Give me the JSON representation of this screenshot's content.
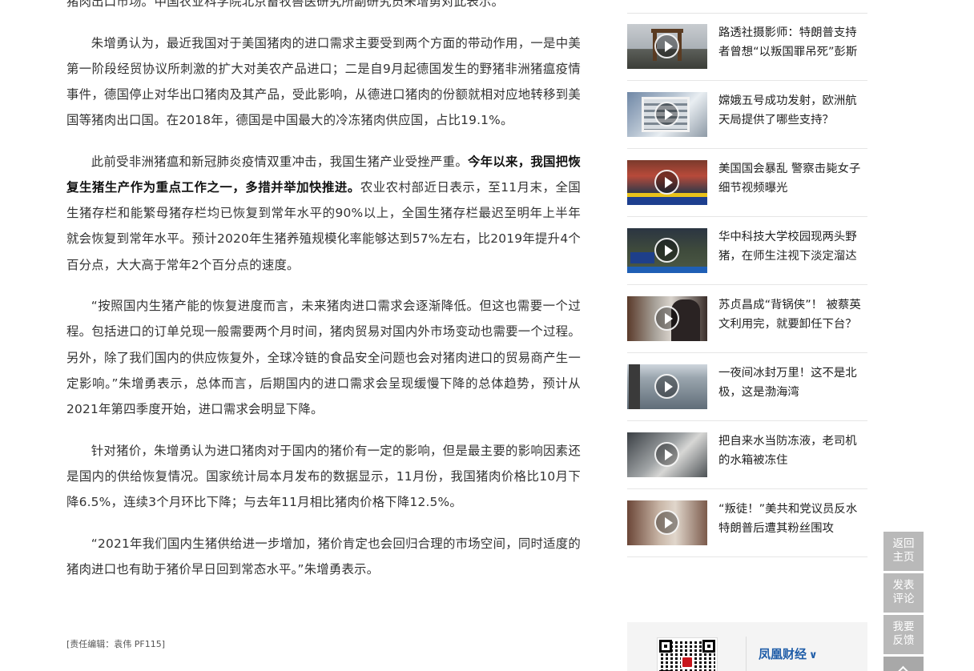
{
  "article": {
    "paragraphs": [
      {
        "parts": [
          {
            "text": "猪肉出口市场。”中国农业科学院北京畜牧兽医研究所副研究员朱增勇对此表示。",
            "bold": false
          }
        ]
      },
      {
        "parts": [
          {
            "text": "朱增勇认为，最近我国对于美国猪肉的进口需求主要受到两个方面的带动作用，一是中美第一阶段经贸协议所刺激的扩大对美农产品进口；二是自9月起德国发生的野猪非洲猪瘟疫情事件，德国停止对华出口猪肉及其产品，受此影响，从德进口猪肉的份额就相对应地转移到美国等猪肉出口国。在2018年，德国是中国最大的冷冻猪肉供应国，占比19.1%。",
            "bold": false
          }
        ]
      },
      {
        "parts": [
          {
            "text": "此前受非洲猪瘟和新冠肺炎疫情双重冲击，我国生猪产业受挫严重。",
            "bold": false
          },
          {
            "text": "今年以来，我国把恢复生猪生产作为重点工作之一，多措并举加快推进。",
            "bold": true
          },
          {
            "text": "农业农村部近日表示，至11月末，全国生猪存栏和能繁母猪存栏均已恢复到常年水平的90%以上，全国生猪存栏最迟至明年上半年就会恢复到常年水平。预计2020年生猪养殖规模化率能够达到57%左右，比2019年提升4个百分点，大大高于常年2个百分点的速度。",
            "bold": false
          }
        ]
      },
      {
        "parts": [
          {
            "text": "“按照国内生猪产能的恢复进度而言，未来猪肉进口需求会逐渐降低。但这也需要一个过程。包括进口的订单兑现一般需要两个月时间，猪肉贸易对国内外市场变动也需要一个过程。另外，除了我们国内的供应恢复外，全球冷链的食品安全问题也会对猪肉进口的贸易商产生一定影响。”朱增勇表示，总体而言，后期国内的进口需求会呈现缓慢下降的总体趋势，预计从2021年第四季度开始，进口需求会明显下降。",
            "bold": false
          }
        ]
      },
      {
        "parts": [
          {
            "text": "针对猪价，朱增勇认为进口猪肉对于国内的猪价有一定的影响，但是最主要的影响因素还是国内的供给恢复情况。国家统计局本月发布的数据显示，11月份，我国猪肉价格比10月下降6.5%，连续3个月环比下降；与去年11月相比猪肉价格下降12.5%。",
            "bold": false
          }
        ]
      },
      {
        "parts": [
          {
            "text": "“2021年我们国内生猪供给进一步增加，猪价肯定也会回归合理的市场空间，同时适度的猪肉进口也有助于猪价早日回到常态水平。”朱增勇表示。",
            "bold": false
          }
        ]
      }
    ],
    "editor": "[责任编辑：袁伟 PF115]"
  },
  "sidebar": {
    "videos": [
      {
        "title": "路透社摄影师：特朗普支持者曾想“以叛国罪吊死”彭斯",
        "thumb": "t1"
      },
      {
        "title": "嫦娥五号成功发射，欧洲航天局提供了哪些支持？",
        "thumb": "t2"
      },
      {
        "title": "美国国会暴乱 警察击毙女子细节视频曝光",
        "thumb": "t3"
      },
      {
        "title": "华中科技大学校园现两头野猪，在师生注视下淡定溜达",
        "thumb": "t4"
      },
      {
        "title": "苏贞昌成“背锅侠”！ 被蔡英文利用完，就要卸任下台？",
        "thumb": "t5"
      },
      {
        "title": "一夜间冰封万里！这不是北极，这是渤海湾",
        "thumb": "t6"
      },
      {
        "title": "把自来水当防冻液，老司机的水箱被冻住",
        "thumb": "t7"
      },
      {
        "title": "“叛徒！”美共和党议员反水特朗普后遭其粉丝围攻",
        "thumb": "t8"
      }
    ],
    "brand": {
      "name": "凤凰财经",
      "arrow": "∨"
    }
  },
  "tools": {
    "home": "返回主页",
    "comment": "发表评论",
    "feedback": "我要反馈"
  },
  "colors": {
    "brand_blue": "#1f5da8",
    "tool_gray": "#b9b9b9",
    "text": "#333333"
  }
}
